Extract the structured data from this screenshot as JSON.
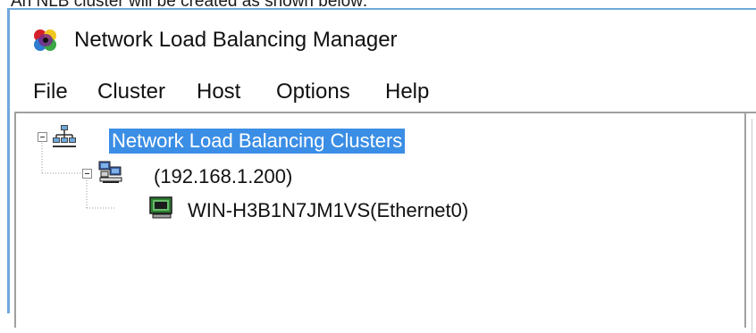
{
  "caption": {
    "text": "An NLB cluster will be created as shown below:"
  },
  "window": {
    "title": "Network Load Balancing Manager"
  },
  "menu": {
    "items": [
      "File",
      "Cluster",
      "Host",
      "Options",
      "Help"
    ]
  },
  "tree": {
    "root": {
      "label": "Network Load Balancing Clusters",
      "icon": "network-clusters-icon",
      "selected": true,
      "expanded": true
    },
    "cluster": {
      "label": "(192.168.1.200)",
      "icon": "cluster-computers-icon",
      "expanded": true
    },
    "host": {
      "label": "WIN-H3B1N7JM1VS(Ethernet0)",
      "icon": "host-computer-icon"
    }
  },
  "colors": {
    "selection": "#3b8ee5",
    "window_border": "#6fa8dc"
  }
}
